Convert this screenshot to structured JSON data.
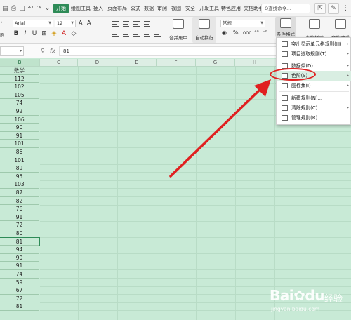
{
  "menubar": {
    "tabs": [
      "开始",
      "绘图工具",
      "插入",
      "页面布局",
      "公式",
      "数据",
      "审阅",
      "视图",
      "安全",
      "开发工具",
      "特色应用",
      "文档助手"
    ],
    "active_tab": "开始",
    "search_placeholder": "Q查找命令...",
    "accent_color": "#2e8b57"
  },
  "ribbon": {
    "left_clip_label_top": "•",
    "left_clip_label_bottom": "刷",
    "font_name": "Arial",
    "font_size": "12",
    "grow_font": "A⁺",
    "shrink_font": "A⁻",
    "merge_label": "合并居中",
    "wrap_label": "自动换行",
    "number_format": "常规",
    "percent": "%",
    "thousands": "000",
    "cond_format_label": "条件格式",
    "table_style_label": "表格样式",
    "doc_helper_label": "文档助手"
  },
  "formula_bar": {
    "fx": "fx",
    "value": "81"
  },
  "columns": [
    "B",
    "C",
    "D",
    "E",
    "F",
    "G",
    "H"
  ],
  "column_b": [
    "数学",
    "112",
    "102",
    "105",
    "74",
    "92",
    "106",
    "90",
    "91",
    "101",
    "86",
    "101",
    "89",
    "95",
    "103",
    "87",
    "82",
    "76",
    "91",
    "72",
    "80",
    "81",
    "94",
    "90",
    "91",
    "74",
    "59",
    "67",
    "72",
    "81"
  ],
  "selected_row_index": 21,
  "dropdown": {
    "items": [
      {
        "label": "突出显示单元格规则(H)",
        "icon": "highlight-rules-icon",
        "arrow": "▸"
      },
      {
        "label": "项目选取规则(T)",
        "icon": "top-bottom-rules-icon",
        "arrow": "▸"
      },
      {
        "label": "数据条(D)",
        "icon": "data-bars-icon",
        "arrow": "▸"
      },
      {
        "label": "色阶(S)",
        "icon": "color-scale-icon",
        "arrow": "▸"
      },
      {
        "label": "图标集(I)",
        "icon": "icon-sets-icon",
        "arrow": "▸"
      },
      {
        "label": "新建规则(N)...",
        "icon": "new-rule-icon",
        "arrow": ""
      },
      {
        "label": "清除规则(C)",
        "icon": "clear-rules-icon",
        "arrow": "▸"
      },
      {
        "label": "管理规则(R)...",
        "icon": "manage-rules-icon",
        "arrow": ""
      }
    ],
    "highlighted": "色阶(S)",
    "annotation_color": "#e02020"
  },
  "watermark": {
    "logo": "Bai",
    "logo_tail": "du",
    "text": "经验",
    "url": "jingyan.baidu.com"
  }
}
